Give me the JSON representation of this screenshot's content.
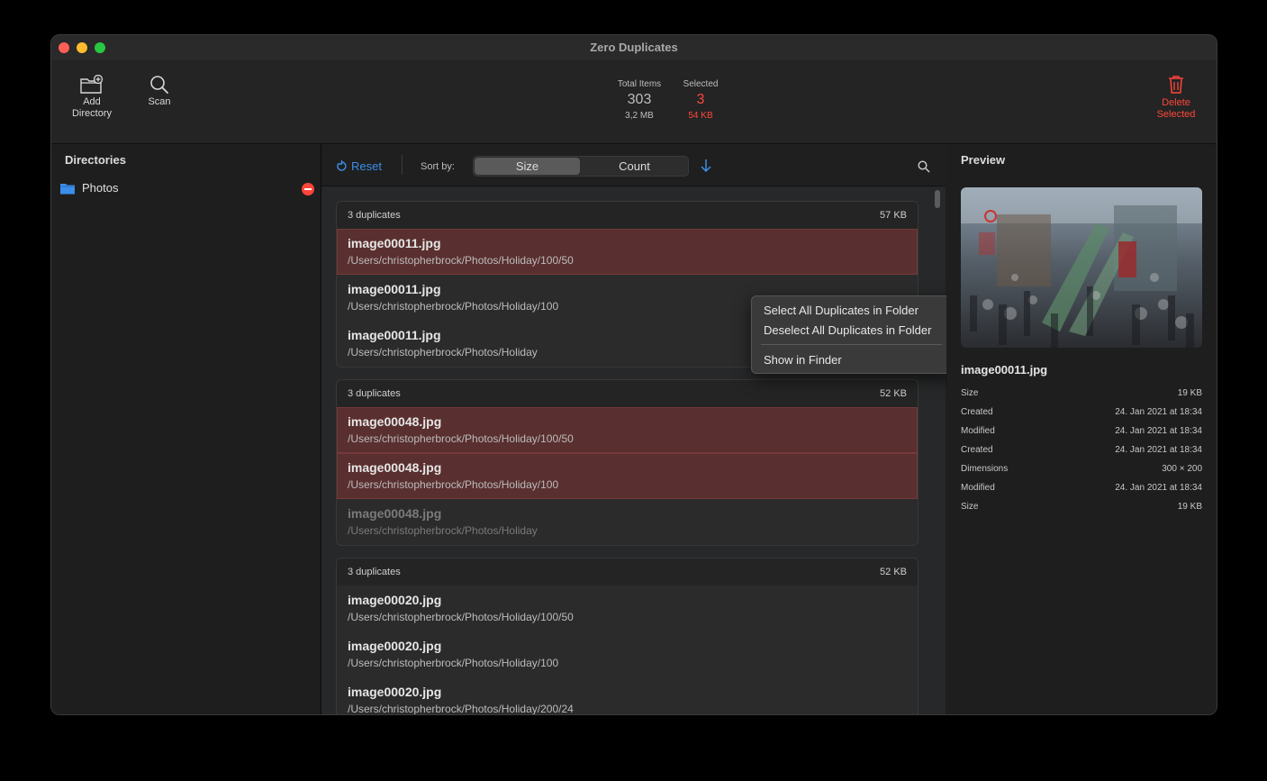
{
  "window": {
    "title": "Zero Duplicates"
  },
  "toolbar": {
    "add_directory_label": "Add\nDirectory",
    "scan_label": "Scan",
    "total_items_label": "Total Items",
    "total_items_value": "303",
    "total_items_size": "3,2 MB",
    "selected_label": "Selected",
    "selected_value": "3",
    "selected_size": "54 KB",
    "delete_selected_label": "Delete\nSelected"
  },
  "sidebar": {
    "title": "Directories",
    "items": [
      {
        "label": "Photos"
      }
    ]
  },
  "filter": {
    "reset_label": "Reset",
    "sort_by_label": "Sort by:",
    "sort_options": [
      "Size",
      "Count"
    ],
    "selected_sort": "Size"
  },
  "groups": [
    {
      "count_label": "3 duplicates",
      "size": "57 KB",
      "rows": [
        {
          "name": "image00011.jpg",
          "path": "/Users/christopherbrock/Photos/Holiday/100/50",
          "state": "selected"
        },
        {
          "name": "image00011.jpg",
          "path": "/Users/christopherbrock/Photos/Holiday/100",
          "state": "normal"
        },
        {
          "name": "image00011.jpg",
          "path": "/Users/christopherbrock/Photos/Holiday",
          "state": "normal"
        }
      ]
    },
    {
      "count_label": "3 duplicates",
      "size": "52 KB",
      "rows": [
        {
          "name": "image00048.jpg",
          "path": "/Users/christopherbrock/Photos/Holiday/100/50",
          "state": "selected"
        },
        {
          "name": "image00048.jpg",
          "path": "/Users/christopherbrock/Photos/Holiday/100",
          "state": "selected"
        },
        {
          "name": "image00048.jpg",
          "path": "/Users/christopherbrock/Photos/Holiday",
          "state": "dim"
        }
      ]
    },
    {
      "count_label": "3 duplicates",
      "size": "52 KB",
      "rows": [
        {
          "name": "image00020.jpg",
          "path": "/Users/christopherbrock/Photos/Holiday/100/50",
          "state": "normal"
        },
        {
          "name": "image00020.jpg",
          "path": "/Users/christopherbrock/Photos/Holiday/100",
          "state": "normal"
        },
        {
          "name": "image00020.jpg",
          "path": "/Users/christopherbrock/Photos/Holiday/200/24",
          "state": "normal"
        }
      ]
    }
  ],
  "context_menu": {
    "items": [
      "Select All Duplicates in Folder",
      "Deselect All Duplicates in Folder",
      "Show in Finder"
    ]
  },
  "preview": {
    "title": "Preview",
    "filename": "image00011.jpg",
    "meta": [
      {
        "key": "Size",
        "value": "19 KB"
      },
      {
        "key": "Created",
        "value": "24. Jan 2021 at 18:34"
      },
      {
        "key": "Modified",
        "value": "24. Jan 2021 at 18:34"
      },
      {
        "key": "Created",
        "value": "24. Jan 2021 at 18:34"
      },
      {
        "key": "Dimensions",
        "value": "300 × 200"
      },
      {
        "key": "Modified",
        "value": "24. Jan 2021 at 18:34"
      },
      {
        "key": "Size",
        "value": "19 KB"
      }
    ]
  },
  "colors": {
    "accent_blue": "#3b8eea",
    "destructive_red": "#ff453a",
    "selected_row": "#5a2f2f"
  }
}
